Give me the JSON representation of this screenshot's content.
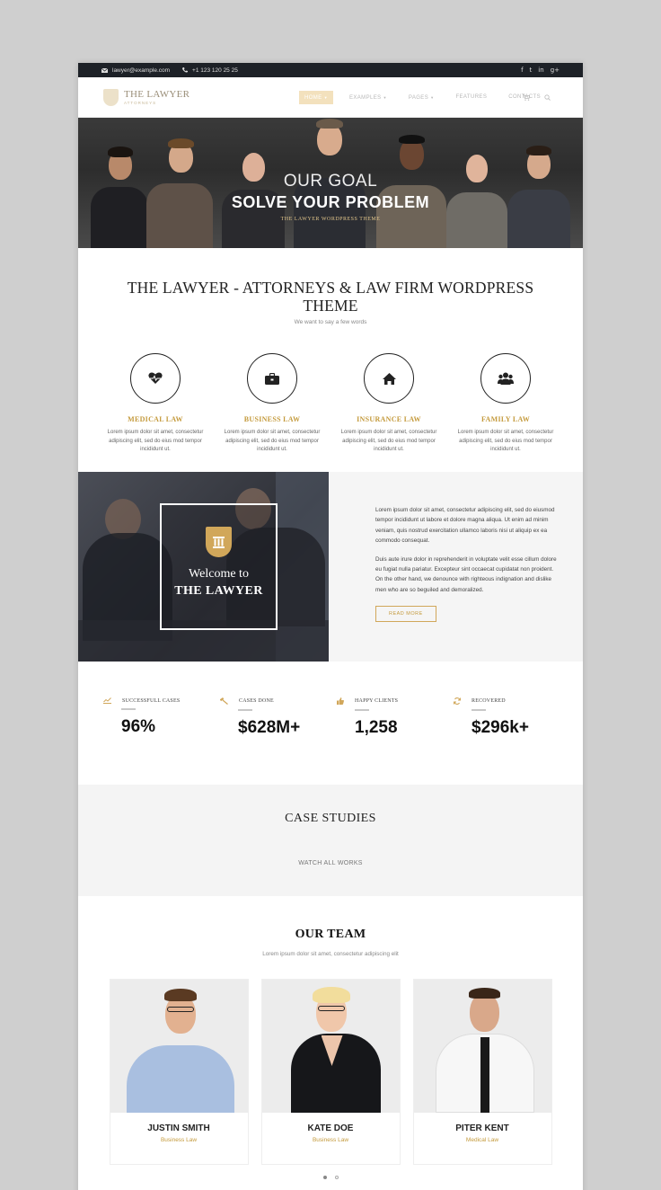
{
  "topbar": {
    "email": "lawyer@example.com",
    "phone": "+1 123 120 25 25",
    "social": [
      "f",
      "t",
      "in",
      "g+"
    ]
  },
  "header": {
    "logo_title": "THE LAWYER",
    "logo_sub": "ATTORNEYS",
    "nav": [
      {
        "label": "HOME",
        "caret": "▼"
      },
      {
        "label": "EXAMPLES",
        "caret": "▼"
      },
      {
        "label": "PAGES",
        "caret": "▼"
      },
      {
        "label": "FEATURES",
        "caret": ""
      },
      {
        "label": "CONTACTS",
        "caret": ""
      }
    ],
    "icons": [
      "cart-icon",
      "search-icon"
    ]
  },
  "hero": {
    "line1": "OUR GOAL",
    "line2": "SOLVE YOUR PROBLEM",
    "line3": "THE LAWYER WORDPRESS THEME"
  },
  "intro": {
    "title": "THE LAWYER - ATTORNEYS & LAW FIRM WORDPRESS THEME",
    "subtitle": "We want to say a few words"
  },
  "services": [
    {
      "icon": "heart-pulse-icon",
      "title": "MEDICAL LAW",
      "text": "Lorem ipsum dolor sit amet, consectetur adipiscing elit, sed do eius mod tempor incididunt ut."
    },
    {
      "icon": "briefcase-icon",
      "title": "BUSINESS LAW",
      "text": "Lorem ipsum dolor sit amet, consectetur adipiscing elit, sed do eius mod tempor incididunt ut."
    },
    {
      "icon": "home-icon",
      "title": "INSURANCE LAW",
      "text": "Lorem ipsum dolor sit amet, consectetur adipiscing elit, sed do eius mod tempor incididunt ut."
    },
    {
      "icon": "users-icon",
      "title": "FAMILY LAW",
      "text": "Lorem ipsum dolor sit amet, consectetur adipiscing elit, sed do eius mod tempor incididunt ut."
    }
  ],
  "welcome": {
    "line1": "Welcome to",
    "line2": "THE LAWYER",
    "para1": "Lorem ipsum dolor sit amet, consectetur adipiscing elit, sed do eiusmod tempor incididunt ut labore et dolore magna aliqua. Ut enim ad minim veniam, quis nostrud exercitation ullamco laboris nisi ut aliquip ex ea commodo consequat.",
    "para2": "Duis aute irure dolor in reprehenderit in voluptate velit esse cillum dolore eu fugiat nulla pariatur. Excepteur sint occaecat cupidatat non proident. On the other hand, we denounce with righteous indignation and dislike men who are so beguiled and demoralized.",
    "read_more": "READ MORE"
  },
  "stats": [
    {
      "icon": "chart-icon",
      "label": "SUCCESSFULL CASES",
      "value": "96%"
    },
    {
      "icon": "gavel-icon",
      "label": "CASES DONE",
      "value": "$628M+"
    },
    {
      "icon": "thumbs-up-icon",
      "label": "HAPPY CLIENTS",
      "value": "1,258"
    },
    {
      "icon": "refresh-icon",
      "label": "RECOVERED",
      "value": "$296k+"
    }
  ],
  "cases": {
    "title": "CASE STUDIES",
    "link": "WATCH ALL WORKS"
  },
  "team": {
    "title": "OUR TEAM",
    "subtitle": "Lorem ipsum dolor sit amet, consectetur adipiscing elit",
    "members": [
      {
        "name": "JUSTIN SMITH",
        "role": "Business Law"
      },
      {
        "name": "KATE DOE",
        "role": "Business Law"
      },
      {
        "name": "PITER KENT",
        "role": "Medical Law"
      }
    ]
  },
  "colors": {
    "accent": "#c49a3c",
    "dark": "#1d2127"
  }
}
